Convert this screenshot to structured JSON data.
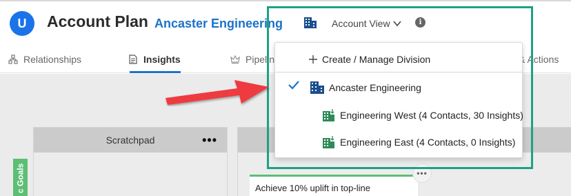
{
  "header": {
    "logo_letter": "U",
    "title": "Account Plan",
    "account_name": "Ancaster Engineering",
    "view_selector": "Account View"
  },
  "tabs": [
    {
      "label": "Relationships",
      "icon": "org-chart-icon",
      "active": false
    },
    {
      "label": "Insights",
      "icon": "document-icon",
      "active": true
    },
    {
      "label": "Pipeline",
      "icon": "crown-icon",
      "active": false
    },
    {
      "label": "& Actions",
      "icon": "",
      "active": false
    }
  ],
  "dropdown": {
    "create_label": "Create / Manage Division",
    "items": [
      {
        "label": "Ancaster Engineering",
        "selected": true,
        "icon": "building-icon"
      },
      {
        "label": "Engineering West (4 Contacts, 30 Insights)",
        "selected": false,
        "icon": "division-building-icon"
      },
      {
        "label": "Engineering East (4 Contacts, 0 Insights)",
        "selected": false,
        "icon": "division-building-icon"
      }
    ]
  },
  "board": {
    "scratchpad_title": "Scratchpad",
    "more_glyph": "•••",
    "goals_label": "c Goals",
    "card_text": "Achieve 10% uplift in top-line",
    "card_more_glyph": "•••"
  },
  "colors": {
    "accent_blue": "#1b72c9",
    "highlight_teal": "#1ea085",
    "annotation_red": "#ee3a3f",
    "goals_green": "#5cbf74",
    "division_icon_green": "#2e8b57"
  }
}
